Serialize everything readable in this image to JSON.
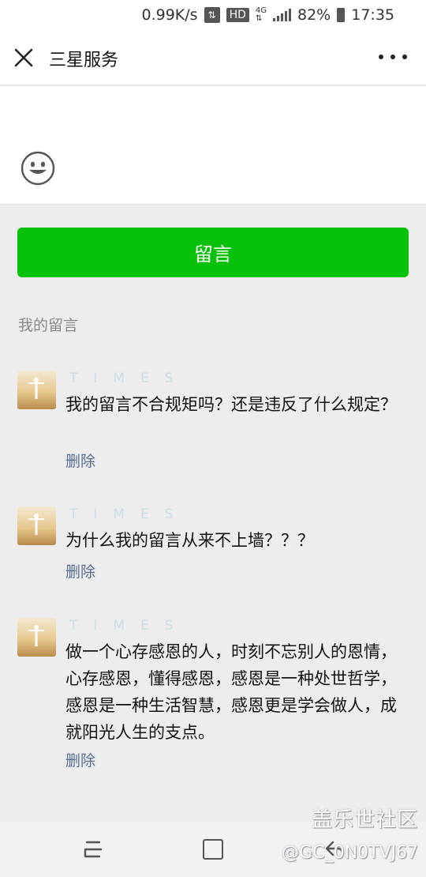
{
  "status_bar": {
    "speed": "0.99K/s",
    "swap_icon": "data-transfer-icon",
    "hd": "HD",
    "network_top": "4G",
    "network_bottom": "⇅",
    "signal_icon": "signal-bars-icon",
    "battery_percent": "82%",
    "battery_icon": "battery-icon",
    "time": "17:35"
  },
  "title_bar": {
    "title": "三星服务",
    "close_icon": "close-icon",
    "more_icon": "more-dots-icon"
  },
  "input_area": {
    "emoji_icon": "emoji-smile-icon"
  },
  "submit_button": {
    "label": "留言",
    "color": "#07c10a"
  },
  "my_comments": {
    "section_title": "我的留言",
    "items": [
      {
        "nickname": "TIMES",
        "text": "我的留言不合规矩吗？还是违反了什么规定？",
        "delete_label": "删除"
      },
      {
        "nickname": "TIMES",
        "text": "为什么我的留言从来不上墙？？？",
        "delete_label": "删除"
      },
      {
        "nickname": "TIMES",
        "text": "做一个心存感恩的人，时刻不忘别人的恩情，心存感恩，懂得感恩，感恩是一种处世哲学，感恩是一种生活智慧，感恩更是学会做人，成就阳光人生的支点。",
        "delete_label": "删除"
      }
    ]
  },
  "nav_bar": {
    "recent_icon": "recent-apps-icon",
    "home_icon": "home-icon",
    "back_icon": "back-icon"
  },
  "watermark": {
    "line1": "盖乐世社区",
    "line2": "@GC_0N0TVJ67"
  }
}
